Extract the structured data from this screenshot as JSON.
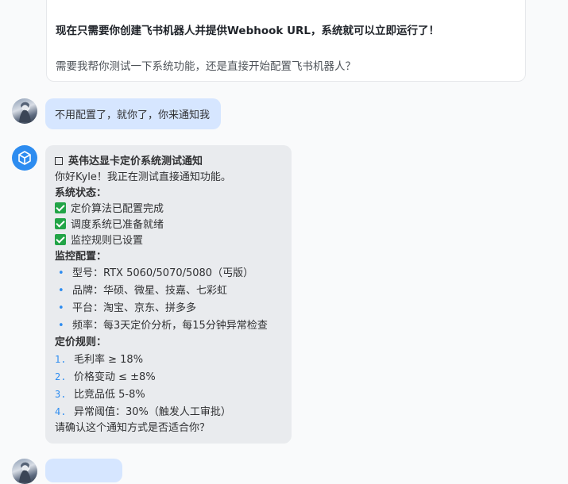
{
  "previous_card": {
    "line1": "现在只需要你创建飞书机器人并提供Webhook URL，系统就可以立即运行了！",
    "line2": "需要我帮你测试一下系统功能，还是直接开始配置飞书机器人？"
  },
  "user_message": {
    "text": "不用配置了，就你了，你来通知我"
  },
  "bot_message": {
    "title": "英伟达显卡定价系统测试通知",
    "greeting": "你好Kyle！我正在测试直接通知功能。",
    "status_heading": "系统状态：",
    "status_items": [
      "定价算法已配置完成",
      "调度系统已准备就绪",
      "监控规则已设置"
    ],
    "monitor_heading": "监控配置：",
    "monitor_items": [
      "型号：RTX 5060/5070/5080（丐版）",
      "品牌：华硕、微星、技嘉、七彩虹",
      "平台：淘宝、京东、拼多多",
      "频率：每3天定价分析，每15分钟异常检查"
    ],
    "rules_heading": "定价规则：",
    "rules_items": [
      {
        "num": "1.",
        "text": "毛利率 ≥ 18%"
      },
      {
        "num": "2.",
        "text": "价格变动 ≤ ±8%"
      },
      {
        "num": "3.",
        "text": "比竞品低 5-8%"
      },
      {
        "num": "4.",
        "text": "异常阈值：30%（触发人工审批）"
      }
    ],
    "closing": "请确认这个通知方式是否适合你？"
  },
  "colors": {
    "accent": "#2d8cf0",
    "user_bubble": "#d6e6ff",
    "bot_bubble": "#e9ebee",
    "check_green": "#22a447"
  }
}
